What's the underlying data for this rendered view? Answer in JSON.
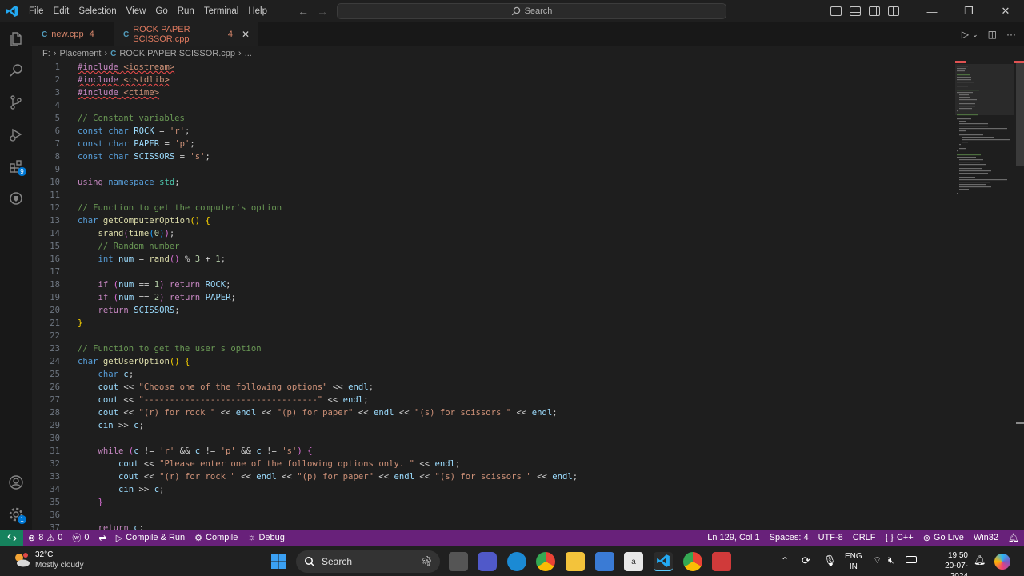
{
  "titlebar": {
    "menu": [
      "File",
      "Edit",
      "Selection",
      "View",
      "Go",
      "Run",
      "Terminal",
      "Help"
    ],
    "search_placeholder": "Search"
  },
  "activity": {
    "extensions_badge": "9",
    "settings_badge": "1"
  },
  "tabs": [
    {
      "name": "new.cpp",
      "problems": "4",
      "active": false
    },
    {
      "name": "ROCK PAPER SCISSOR.cpp",
      "problems": "4",
      "active": true
    }
  ],
  "breadcrumb": {
    "drive": "F:",
    "folder": "Placement",
    "file": "ROCK PAPER SCISSOR.cpp",
    "more": "..."
  },
  "code_lines": [
    {
      "n": "1"
    },
    {
      "n": "2"
    },
    {
      "n": "3"
    },
    {
      "n": "4"
    },
    {
      "n": "5"
    },
    {
      "n": "6"
    },
    {
      "n": "7"
    },
    {
      "n": "8"
    },
    {
      "n": "9"
    },
    {
      "n": "10"
    },
    {
      "n": "11"
    },
    {
      "n": "12"
    },
    {
      "n": "13"
    },
    {
      "n": "14"
    },
    {
      "n": "15"
    },
    {
      "n": "16"
    },
    {
      "n": "17"
    },
    {
      "n": "18"
    },
    {
      "n": "19"
    },
    {
      "n": "20"
    },
    {
      "n": "21"
    },
    {
      "n": "22"
    },
    {
      "n": "23"
    },
    {
      "n": "24"
    },
    {
      "n": "25"
    },
    {
      "n": "26"
    },
    {
      "n": "27"
    },
    {
      "n": "28"
    },
    {
      "n": "29"
    },
    {
      "n": "30"
    },
    {
      "n": "31"
    },
    {
      "n": "32"
    },
    {
      "n": "33"
    },
    {
      "n": "34"
    },
    {
      "n": "35"
    },
    {
      "n": "36"
    },
    {
      "n": "37"
    }
  ],
  "code": {
    "l1a": "#include",
    "l1b": "<iostream>",
    "l2a": "#include",
    "l2b": "<cstdlib>",
    "l3a": "#include",
    "l3b": "<ctime>",
    "l5": "// Constant variables",
    "const": "const",
    "char": "char",
    "rock": "ROCK",
    "rock_v": "'r'",
    "paper": "PAPER",
    "paper_v": "'p'",
    "scissors": "SCISSORS",
    "scissors_v": "'s'",
    "using": "using",
    "namespace": "namespace",
    "std": "std",
    "l12": "// Function to get the computer's option",
    "getcomp": "getComputerOption",
    "srand": "srand",
    "time": "time",
    "zero": "0",
    "l15": "// Random number",
    "int": "int",
    "num": "num",
    "rand": "rand",
    "three": "3",
    "one": "1",
    "two": "2",
    "if": "if",
    "return": "return",
    "l23": "// Function to get the user's option",
    "getuser": "getUserOption",
    "c": "c",
    "cout": "cout",
    "cin": "cin",
    "endl": "endl",
    "s26": "\"Choose one of the following options\"",
    "s27": "\"----------------------------------\"",
    "s_r": "\"(r) for rock \"",
    "s_p": "\"(p) for paper\"",
    "s_s": "\"(s) for scissors \"",
    "while": "while",
    "ch_r": "'r'",
    "ch_p": "'p'",
    "ch_s": "'s'",
    "s32": "\"Please enter one of the following options only. \""
  },
  "status": {
    "errors": "8",
    "warnings": "0",
    "infos": "0",
    "compile_run": "Compile & Run",
    "compile": "Compile",
    "debug": "Debug",
    "position": "Ln 129, Col 1",
    "spaces": "Spaces: 4",
    "encoding": "UTF-8",
    "eol": "CRLF",
    "language": "C++",
    "golive": "Go Live",
    "platform": "Win32"
  },
  "taskbar": {
    "weather_temp": "32°C",
    "weather_desc": "Mostly cloudy",
    "search": "Search",
    "lang1": "ENG",
    "lang2": "IN",
    "time": "19:50",
    "date": "20-07-2024"
  },
  "colors": {
    "statusbar": "#68217a",
    "remote": "#16825d",
    "accent": "#0078d4"
  }
}
